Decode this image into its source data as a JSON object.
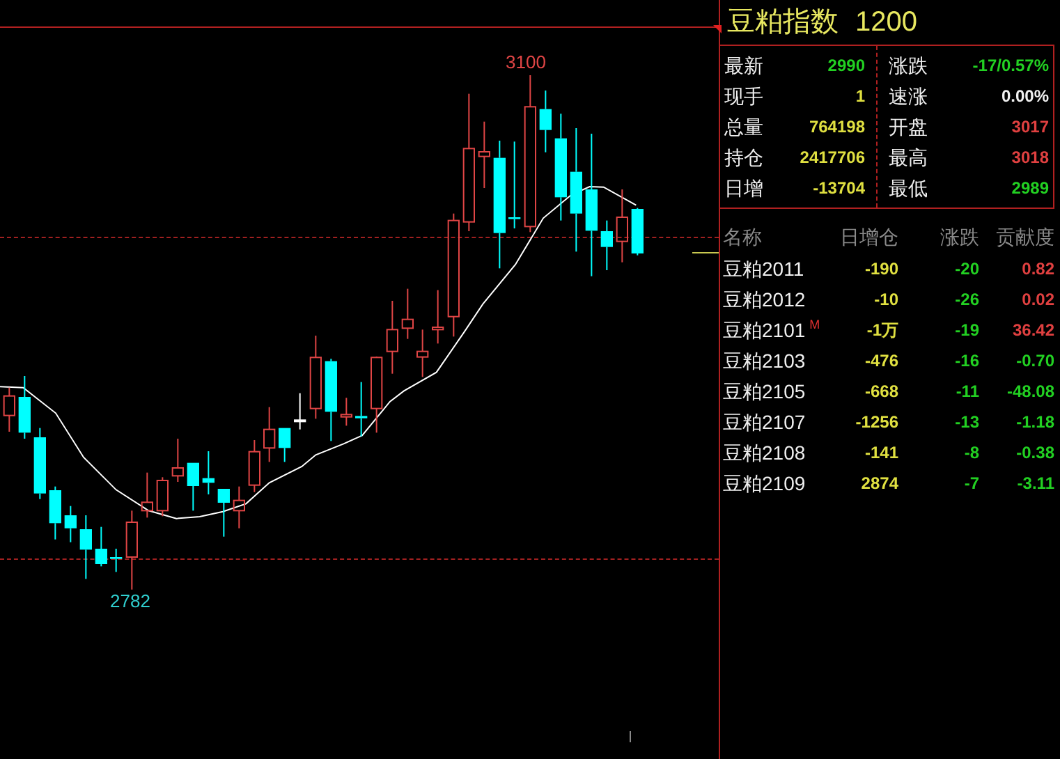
{
  "chart": {
    "high_label": "3100",
    "low_label": "2782"
  },
  "panel": {
    "title": "豆粕指数",
    "code": "1200",
    "quotes": [
      {
        "label": "最新",
        "value": "2990",
        "color": "#22d022"
      },
      {
        "label": "涨跌",
        "value": "-17/0.57%",
        "color": "#22d022"
      },
      {
        "label": "现手",
        "value": "1",
        "color": "#e0e040"
      },
      {
        "label": "速涨",
        "value": "0.00%",
        "color": "#f0f0f0"
      },
      {
        "label": "总量",
        "value": "764198",
        "color": "#e0e040"
      },
      {
        "label": "开盘",
        "value": "3017",
        "color": "#e04040"
      },
      {
        "label": "持仓",
        "value": "2417706",
        "color": "#e0e040"
      },
      {
        "label": "最高",
        "value": "3018",
        "color": "#e04040"
      },
      {
        "label": "日增",
        "value": "-13704",
        "color": "#e0e040"
      },
      {
        "label": "最低",
        "value": "2989",
        "color": "#22d022"
      }
    ],
    "table": {
      "columns": [
        "名称",
        "日增仓",
        "涨跌",
        "贡献度"
      ],
      "rows": [
        {
          "name": "豆粕2011",
          "oi_change": "-190",
          "change": "-20",
          "contribution": "0.82",
          "color": "#e04040"
        },
        {
          "name": "豆粕2012",
          "oi_change": "-10",
          "change": "-26",
          "contribution": "0.02",
          "color": "#e04040"
        },
        {
          "name": "豆粕2101",
          "mark": "M",
          "oi_change": "-1万",
          "change": "-19",
          "contribution": "36.42",
          "color": "#e04040"
        },
        {
          "name": "豆粕2103",
          "oi_change": "-476",
          "change": "-16",
          "contribution": "-0.70",
          "color": "#22d022"
        },
        {
          "name": "豆粕2105",
          "oi_change": "-668",
          "change": "-11",
          "contribution": "-48.08",
          "color": "#22d022"
        },
        {
          "name": "豆粕2107",
          "oi_change": "-1256",
          "change": "-13",
          "contribution": "-1.18",
          "color": "#22d022"
        },
        {
          "name": "豆粕2108",
          "oi_change": "-141",
          "change": "-8",
          "contribution": "-0.38",
          "color": "#22d022"
        },
        {
          "name": "豆粕2109",
          "oi_change": "2874",
          "change": "-7",
          "contribution": "-3.11",
          "color": "#22d022"
        }
      ]
    }
  }
}
